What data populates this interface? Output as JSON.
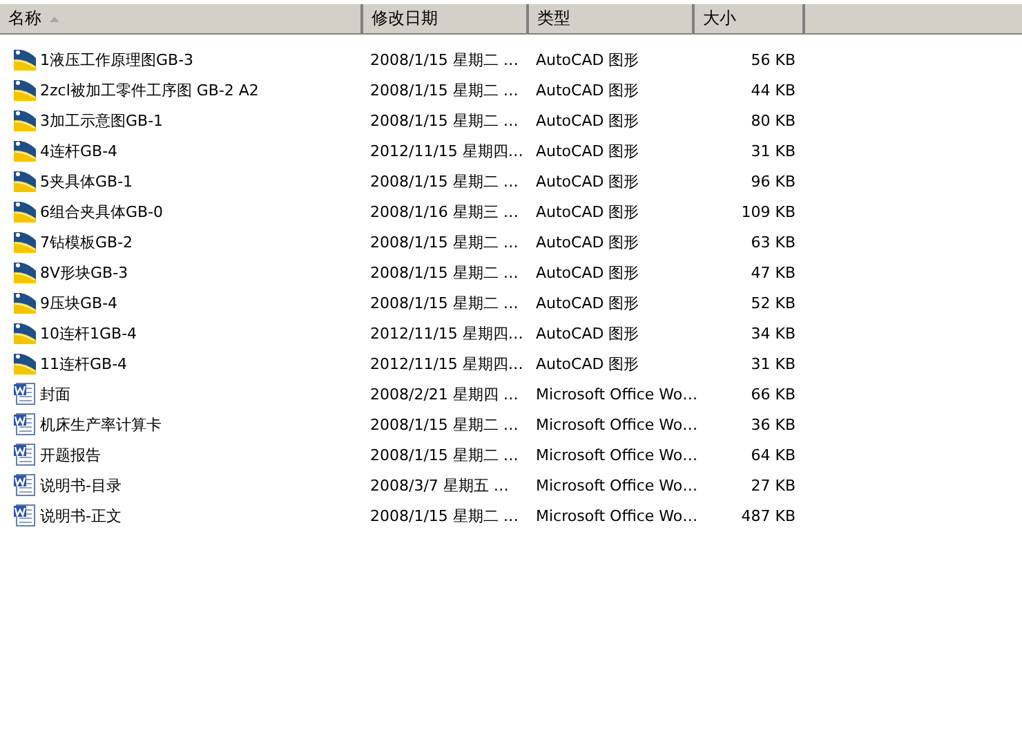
{
  "columns": [
    {
      "label": "名称",
      "sorted": true
    },
    {
      "label": "修改日期",
      "sorted": false
    },
    {
      "label": "类型",
      "sorted": false
    },
    {
      "label": "大小",
      "sorted": false
    }
  ],
  "files": [
    {
      "kind": "dwg",
      "name": "1液压工作原理图GB-3",
      "date": "2008/1/15 星期二 …",
      "type": "AutoCAD 图形",
      "size": "56 KB"
    },
    {
      "kind": "dwg",
      "name": "2zcl被加工零件工序图  GB-2 A2",
      "date": "2008/1/15 星期二 …",
      "type": "AutoCAD 图形",
      "size": "44 KB"
    },
    {
      "kind": "dwg",
      "name": "3加工示意图GB-1",
      "date": "2008/1/15 星期二 …",
      "type": "AutoCAD 图形",
      "size": "80 KB"
    },
    {
      "kind": "dwg",
      "name": "4连杆GB-4",
      "date": "2012/11/15 星期四…",
      "type": "AutoCAD 图形",
      "size": "31 KB"
    },
    {
      "kind": "dwg",
      "name": "5夹具体GB-1",
      "date": "2008/1/15 星期二 …",
      "type": "AutoCAD 图形",
      "size": "96 KB"
    },
    {
      "kind": "dwg",
      "name": "6组合夹具体GB-0",
      "date": "2008/1/16 星期三 …",
      "type": "AutoCAD 图形",
      "size": "109 KB"
    },
    {
      "kind": "dwg",
      "name": "7钻模板GB-2",
      "date": "2008/1/15 星期二 …",
      "type": "AutoCAD 图形",
      "size": "63 KB"
    },
    {
      "kind": "dwg",
      "name": "8V形块GB-3",
      "date": "2008/1/15 星期二 …",
      "type": "AutoCAD 图形",
      "size": "47 KB"
    },
    {
      "kind": "dwg",
      "name": "9压块GB-4",
      "date": "2008/1/15 星期二 …",
      "type": "AutoCAD 图形",
      "size": "52 KB"
    },
    {
      "kind": "dwg",
      "name": "10连杆1GB-4",
      "date": "2012/11/15 星期四…",
      "type": "AutoCAD 图形",
      "size": "34 KB"
    },
    {
      "kind": "dwg",
      "name": "11连杆GB-4",
      "date": "2012/11/15 星期四…",
      "type": "AutoCAD 图形",
      "size": "31 KB"
    },
    {
      "kind": "doc",
      "name": "封面",
      "date": "2008/2/21 星期四 …",
      "type": "Microsoft Office Wo…",
      "size": "66 KB"
    },
    {
      "kind": "doc",
      "name": "机床生产率计算卡",
      "date": "2008/1/15 星期二 …",
      "type": "Microsoft Office Wo…",
      "size": "36 KB"
    },
    {
      "kind": "doc",
      "name": "开题报告",
      "date": "2008/1/15 星期二 …",
      "type": "Microsoft Office Wo…",
      "size": "64 KB"
    },
    {
      "kind": "doc",
      "name": "说明书-目录",
      "date": "2008/3/7 星期五 …",
      "type": "Microsoft Office Wo…",
      "size": "27 KB"
    },
    {
      "kind": "doc",
      "name": "说明书-正文",
      "date": "2008/1/15 星期二 …",
      "type": "Microsoft Office Wo…",
      "size": "487 KB"
    }
  ]
}
